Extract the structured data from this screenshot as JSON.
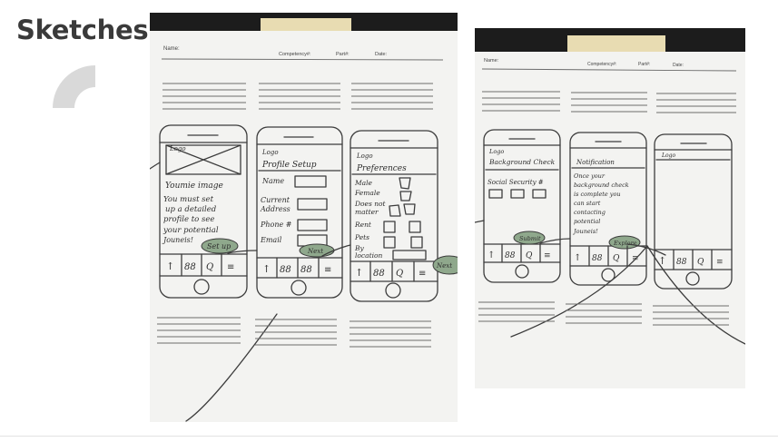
{
  "title": "Sketches",
  "photos": [
    {
      "header": {
        "name": "Name:",
        "competency": "Competency#:",
        "part": "Part#:",
        "date": "Date:"
      },
      "phones": [
        {
          "logo": "Logo",
          "heading": "",
          "lines": [
            "Youmie image",
            "You must set",
            "up a detailed",
            "profile to see",
            "your potential",
            "Jouneis!"
          ],
          "button": "Set up"
        },
        {
          "logo": "Logo",
          "heading": "Profile Setup",
          "lines": [
            "Name",
            "Current",
            "Address",
            "Phone #",
            "Email"
          ],
          "button": "Next"
        },
        {
          "logo": "Logo",
          "heading": "Preferences",
          "lines": [
            "Male",
            "Female",
            "Does not",
            "matter",
            "Rent",
            "Pets",
            "By",
            "location"
          ],
          "button": ""
        }
      ],
      "edge_label": "Next"
    },
    {
      "header": {
        "name": "Name:",
        "competency": "Competency#:",
        "part": "Part#:",
        "date": "Date:"
      },
      "phones": [
        {
          "logo": "Logo",
          "heading": "Background Check",
          "lines": [
            "Social Security #"
          ],
          "button": "Submit"
        },
        {
          "logo": "",
          "heading": "Notification",
          "lines": [
            "Once your",
            "background check",
            "is complete you",
            "can start",
            "contacting",
            "potential",
            "Jouneis!"
          ],
          "button": "Explore"
        },
        {
          "logo": "Logo",
          "heading": "",
          "lines": [],
          "button": ""
        }
      ]
    }
  ],
  "colors": {
    "title": "#3a3a3a",
    "paper": "#f4f4f2",
    "button_green": "#8fa88c",
    "backdrop": "#1e1e1e"
  }
}
